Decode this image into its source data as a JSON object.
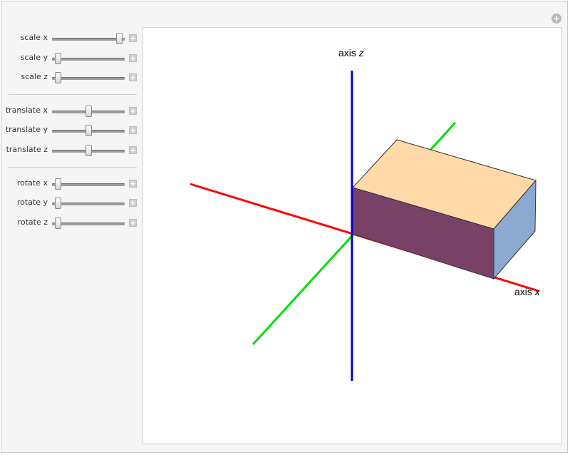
{
  "sliders": {
    "scale": [
      {
        "label": "scale x",
        "value": 0.92
      },
      {
        "label": "scale y",
        "value": 0.08
      },
      {
        "label": "scale z",
        "value": 0.08
      }
    ],
    "translate": [
      {
        "label": "translate x",
        "value": 0.5
      },
      {
        "label": "translate y",
        "value": 0.5
      },
      {
        "label": "translate z",
        "value": 0.5
      }
    ],
    "rotate": [
      {
        "label": "rotate x",
        "value": 0.08
      },
      {
        "label": "rotate y",
        "value": 0.08
      },
      {
        "label": "rotate z",
        "value": 0.08
      }
    ]
  },
  "plot": {
    "axis_z_label": "axis",
    "axis_z_var": "z",
    "axis_x_label": "axis",
    "axis_x_var": "x"
  },
  "colors": {
    "axis_x": "#ff0000",
    "axis_y": "#00e000",
    "axis_z": "#0000cc",
    "box_top": "#ffd9a8",
    "box_front": "#7a4168",
    "box_side": "#8aa8d0"
  }
}
